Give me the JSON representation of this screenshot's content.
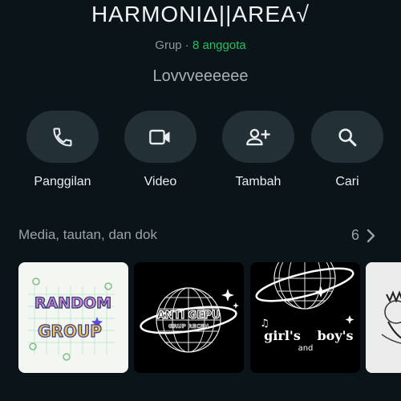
{
  "group": {
    "name": "HARMONIΔ||AREA√",
    "type_label": "Grup · ",
    "member_count_label": "8 anggota",
    "description": "Lovvveeeeee"
  },
  "actions": [
    {
      "label": "Panggilan",
      "icon": "phone-icon"
    },
    {
      "label": "Video",
      "icon": "video-camera-icon"
    },
    {
      "label": "Tambah",
      "icon": "add-person-icon"
    },
    {
      "label": "Cari",
      "icon": "search-icon"
    }
  ],
  "media": {
    "title": "Media, tautan, dan dok",
    "count": "6",
    "thumbnails": [
      {
        "text_1": "RANDOM",
        "text_2": "GROUP"
      },
      {
        "text_1": "ANTI GEPU",
        "text_2": "GRUP RECEH"
      },
      {
        "text_1": "girl's",
        "text_2": "and",
        "text_3": "boy's"
      },
      {}
    ]
  },
  "colors": {
    "background": "#0b1418",
    "button_bg": "#233036",
    "accent_green": "#21c063",
    "muted_text": "#8d979c"
  }
}
